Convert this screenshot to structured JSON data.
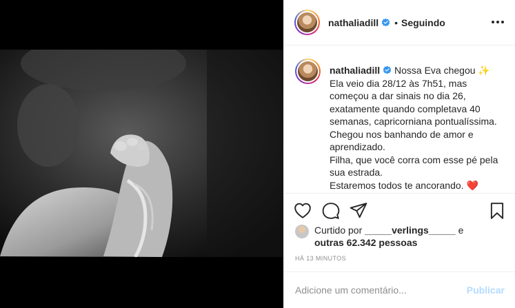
{
  "post": {
    "username": "nathaliadill",
    "follow_status": "Seguindo",
    "separator": "•"
  },
  "caption": {
    "username": "nathaliadill",
    "lines": [
      "Nossa Eva chegou ✨",
      "Ela veio dia 28/12 às 7h51, mas",
      "começou a dar sinais no dia 26,",
      "exatamente quando completava 40",
      "semanas, capricorniana pontualíssima.",
      "Chegou nos banhando de amor e",
      "aprendizado.",
      "Filha, que você corra com esse pé pela",
      "sua estrada.",
      "Estaremos todos te ancorando. ❤️"
    ]
  },
  "likes": {
    "prefix": "Curtido por",
    "liker": "_____verlings_____",
    "connector": "e",
    "others": "outras 62.342 pessoas"
  },
  "timestamp": "HÁ 13 MINUTOS",
  "comment": {
    "placeholder": "Adicione um comentário...",
    "value": "",
    "publish_label": "Publicar"
  },
  "icons": {
    "like": "heart-icon",
    "comment": "comment-bubble-icon",
    "share": "paper-plane-icon",
    "save": "bookmark-icon",
    "more": "more-options-icon",
    "verified": "verified-badge-icon"
  },
  "colors": {
    "verified": "#3897f0",
    "publish_disabled": "#b3dbff",
    "muted": "#8e8e8e",
    "heart": "#ed4956"
  }
}
